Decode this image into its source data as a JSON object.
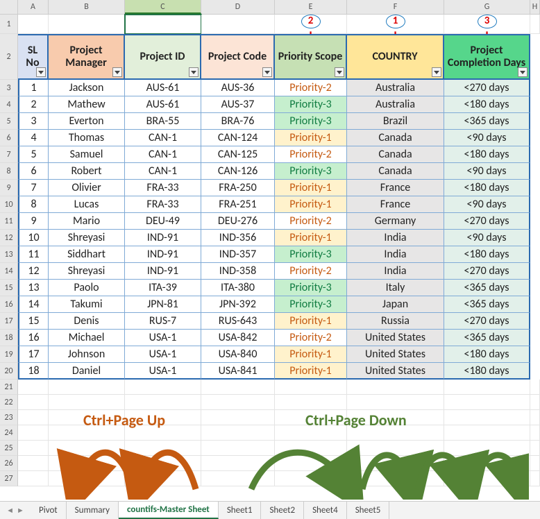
{
  "col_labels": {
    "A": "A",
    "B": "B",
    "C": "C",
    "D": "D",
    "E": "E",
    "F": "F",
    "G": "G",
    "H": "H"
  },
  "headers": {
    "sl": "SL No",
    "pm": "Project Manager",
    "pid": "Project ID",
    "pc": "Project Code",
    "ps": "Priority Scope",
    "co": "COUNTRY",
    "pcd": "Project Completion Days"
  },
  "badges": {
    "e": "2",
    "f": "1",
    "g": "3"
  },
  "rows": [
    {
      "n": "3",
      "sl": "1",
      "pm": "Jackson",
      "pid": "AUS-61",
      "pc": "AUS-36",
      "ps": "Priority-2",
      "psk": "pri2",
      "co": "Australia",
      "pcd": "<270 days"
    },
    {
      "n": "4",
      "sl": "2",
      "pm": "Mathew",
      "pid": "AUS-61",
      "pc": "AUS-37",
      "ps": "Priority-3",
      "psk": "pri3",
      "co": "Australia",
      "pcd": "<180 days"
    },
    {
      "n": "5",
      "sl": "3",
      "pm": "Everton",
      "pid": "BRA-55",
      "pc": "BRA-76",
      "ps": "Priority-3",
      "psk": "pri3",
      "co": "Brazil",
      "pcd": "<365 days"
    },
    {
      "n": "6",
      "sl": "4",
      "pm": "Thomas",
      "pid": "CAN-1",
      "pc": "CAN-124",
      "ps": "Priority-1",
      "psk": "pri1",
      "co": "Canada",
      "pcd": "<90 days"
    },
    {
      "n": "7",
      "sl": "5",
      "pm": "Samuel",
      "pid": "CAN-1",
      "pc": "CAN-125",
      "ps": "Priority-2",
      "psk": "pri2",
      "co": "Canada",
      "pcd": "<180 days"
    },
    {
      "n": "8",
      "sl": "6",
      "pm": "Robert",
      "pid": "CAN-1",
      "pc": "CAN-126",
      "ps": "Priority-3",
      "psk": "pri3",
      "co": "Canada",
      "pcd": "<90 days"
    },
    {
      "n": "9",
      "sl": "7",
      "pm": "Olivier",
      "pid": "FRA-33",
      "pc": "FRA-250",
      "ps": "Priority-1",
      "psk": "pri1",
      "co": "France",
      "pcd": "<180 days"
    },
    {
      "n": "10",
      "sl": "8",
      "pm": "Lucas",
      "pid": "FRA-33",
      "pc": "FRA-251",
      "ps": "Priority-1",
      "psk": "pri1",
      "co": "France",
      "pcd": "<90 days"
    },
    {
      "n": "11",
      "sl": "9",
      "pm": "Mario",
      "pid": "DEU-49",
      "pc": "DEU-276",
      "ps": "Priority-2",
      "psk": "pri2",
      "co": "Germany",
      "pcd": "<270 days"
    },
    {
      "n": "12",
      "sl": "10",
      "pm": "Shreyasi",
      "pid": "IND-91",
      "pc": "IND-356",
      "ps": "Priority-1",
      "psk": "pri1",
      "co": "India",
      "pcd": "<90 days"
    },
    {
      "n": "13",
      "sl": "11",
      "pm": "Siddhart",
      "pid": "IND-91",
      "pc": "IND-357",
      "ps": "Priority-3",
      "psk": "pri3",
      "co": "India",
      "pcd": "<180 days"
    },
    {
      "n": "14",
      "sl": "12",
      "pm": "Shreyasi",
      "pid": "IND-91",
      "pc": "IND-358",
      "ps": "Priority-2",
      "psk": "pri2",
      "co": "India",
      "pcd": "<270 days"
    },
    {
      "n": "15",
      "sl": "13",
      "pm": "Paolo",
      "pid": "ITA-39",
      "pc": "ITA-380",
      "ps": "Priority-3",
      "psk": "pri3",
      "co": "Italy",
      "pcd": "<365 days"
    },
    {
      "n": "16",
      "sl": "14",
      "pm": "Takumi",
      "pid": "JPN-81",
      "pc": "JPN-392",
      "ps": "Priority-3",
      "psk": "pri3",
      "co": "Japan",
      "pcd": "<365 days"
    },
    {
      "n": "17",
      "sl": "15",
      "pm": "Denis",
      "pid": "RUS-7",
      "pc": "RUS-643",
      "ps": "Priority-1",
      "psk": "pri1",
      "co": "Russia",
      "pcd": "<270 days"
    },
    {
      "n": "18",
      "sl": "16",
      "pm": "Michael",
      "pid": "USA-1",
      "pc": "USA-842",
      "ps": "Priority-2",
      "psk": "pri2",
      "co": "United States",
      "pcd": "<365 days"
    },
    {
      "n": "19",
      "sl": "17",
      "pm": "Johnson",
      "pid": "USA-1",
      "pc": "USA-840",
      "ps": "Priority-1",
      "psk": "pri1",
      "co": "United States",
      "pcd": "<180 days"
    },
    {
      "n": "20",
      "sl": "18",
      "pm": "Daniel",
      "pid": "USA-1",
      "pc": "USA-841",
      "ps": "Priority-1",
      "psk": "pri1",
      "co": "United States",
      "pcd": "<180 days"
    }
  ],
  "blank_rows": [
    "21",
    "22",
    "23",
    "24",
    "25",
    "26",
    "27"
  ],
  "shortcuts": {
    "up": "Ctrl+Page Up",
    "down": "Ctrl+Page Down"
  },
  "tabs": {
    "pivot": "Pivot",
    "summary": "Summary",
    "master": "countifs-Master Sheet",
    "s1": "Sheet1",
    "s2": "Sheet2",
    "s4": "Sheet4",
    "s5": "Sheet5"
  },
  "colors": {
    "accent": "#217346"
  }
}
